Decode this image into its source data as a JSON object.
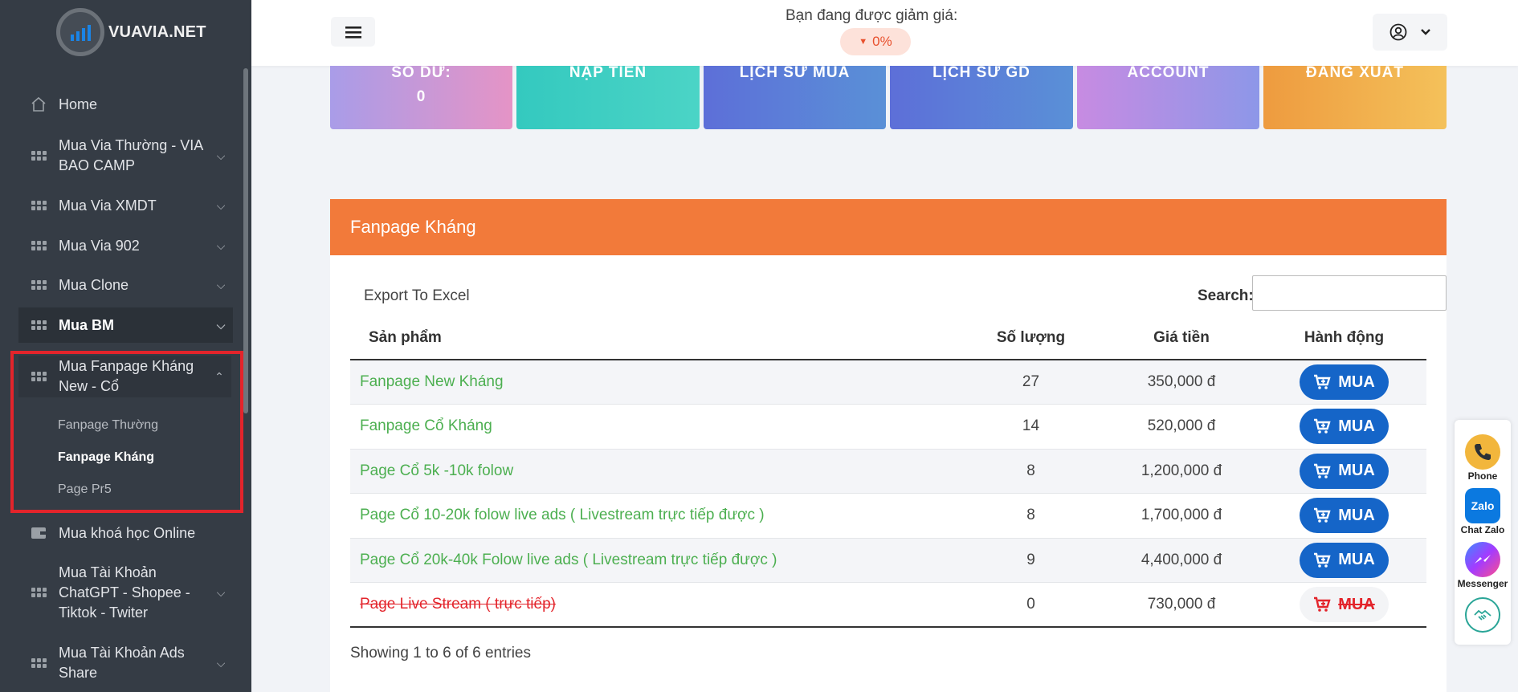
{
  "brand": {
    "name": "VUAVIA.NET"
  },
  "sidebar": {
    "items": [
      {
        "label": "Home",
        "icon": "home-icon"
      },
      {
        "label": "Mua Via Thường - VIA BAO CAMP",
        "icon": "grid-icon"
      },
      {
        "label": "Mua Via XMDT",
        "icon": "grid-icon"
      },
      {
        "label": "Mua Via 902",
        "icon": "grid-icon"
      },
      {
        "label": "Mua Clone",
        "icon": "grid-icon"
      },
      {
        "label": "Mua BM",
        "icon": "grid-icon"
      },
      {
        "label": "Mua Fanpage Kháng New - Cổ",
        "icon": "grid-icon"
      },
      {
        "label": "Mua khoá học Online",
        "icon": "wallet-icon"
      },
      {
        "label": "Mua Tài Khoản ChatGPT - Shopee - Tiktok - Twiter",
        "icon": "grid-icon"
      },
      {
        "label": "Mua Tài Khoản Ads Share",
        "icon": "grid-icon"
      }
    ],
    "subitems": [
      {
        "label": "Fanpage Thường"
      },
      {
        "label": "Fanpage Kháng"
      },
      {
        "label": "Page Pr5"
      }
    ]
  },
  "header": {
    "discount_text": "Bạn đang được giảm giá:",
    "discount_value": "0%"
  },
  "cards": [
    {
      "title": "SỐ DƯ:",
      "value": "0"
    },
    {
      "title": "NẠP TIỀN"
    },
    {
      "title": "LỊCH SỬ MUA"
    },
    {
      "title": "LỊCH SỬ GD"
    },
    {
      "title": "ACCOUNT"
    },
    {
      "title": "ĐĂNG XUẤT"
    }
  ],
  "panel": {
    "title": "Fanpage Kháng",
    "export_label": "Export To Excel",
    "search_label": "Search:",
    "columns": [
      "Sản phẩm",
      "Số lượng",
      "Giá tiền",
      "Hành động"
    ],
    "rows": [
      {
        "product": "Fanpage New Kháng",
        "qty": "27",
        "price": "350,000 đ",
        "action": "MUA"
      },
      {
        "product": "Fanpage Cổ Kháng",
        "qty": "14",
        "price": "520,000 đ",
        "action": "MUA"
      },
      {
        "product": "Page Cổ 5k -10k folow",
        "qty": "8",
        "price": "1,200,000 đ",
        "action": "MUA"
      },
      {
        "product": "Page Cổ 10-20k folow live ads ( Livestream trực tiếp được )",
        "qty": "8",
        "price": "1,700,000 đ",
        "action": "MUA"
      },
      {
        "product": "Page Cổ 20k-40k Folow live ads ( Livestream trực tiếp được )",
        "qty": "9",
        "price": "4,400,000 đ",
        "action": "MUA"
      },
      {
        "product": "Page Live Stream ( trực tiếp)",
        "qty": "0",
        "price": "730,000 đ",
        "action": "MUA"
      }
    ],
    "entries_text": "Showing 1 to 6 of 6 entries"
  },
  "contact": {
    "phone": "Phone",
    "zalo": "Chat Zalo",
    "zalo_logo": "Zalo",
    "messenger": "Messenger"
  },
  "colors": {
    "sidebar_bg": "#353c45",
    "panel_header": "#f27a3a",
    "buy_button": "#1565c8",
    "product_link": "#4caf50",
    "highlight_border": "#e3242b"
  }
}
